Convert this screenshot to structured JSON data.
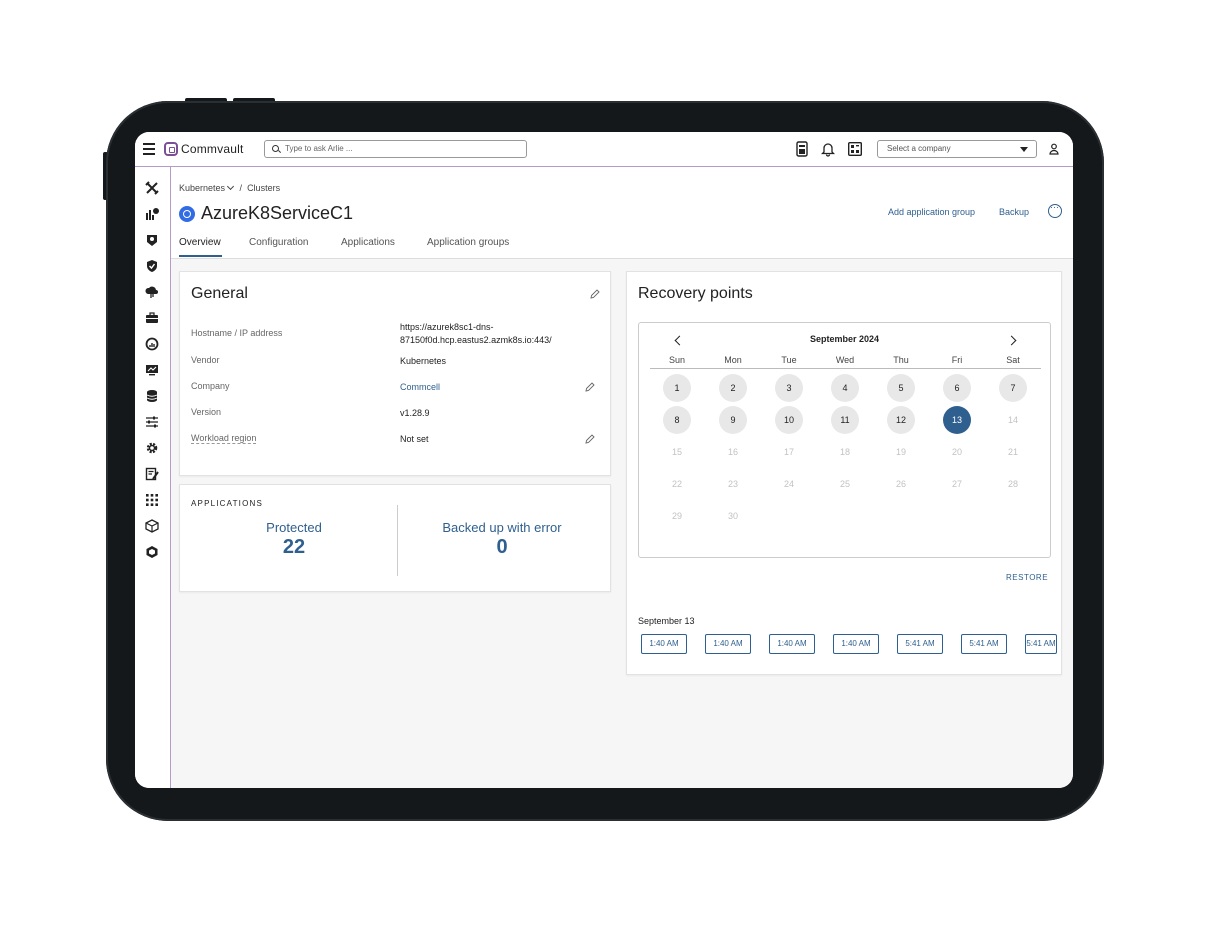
{
  "topbar": {
    "brand": "Commvault",
    "search_placeholder": "Type to ask Arlie ...",
    "company_select": "Select a company"
  },
  "breadcrumb": {
    "parent": "Kubernetes",
    "current": "Clusters"
  },
  "page": {
    "title": "AzureK8ServiceC1",
    "actions": {
      "add_group": "Add application group",
      "backup": "Backup"
    },
    "tabs": [
      "Overview",
      "Configuration",
      "Applications",
      "Application groups"
    ],
    "active_tab": "Overview"
  },
  "general": {
    "title": "General",
    "rows": [
      {
        "label": "Hostname / IP address",
        "value_line1": "https://azurek8sc1-dns-",
        "value_line2": "87150f0d.hcp.eastus2.azmk8s.io:443/"
      },
      {
        "label": "Vendor",
        "value": "Kubernetes"
      },
      {
        "label": "Company",
        "value": "Commcell"
      },
      {
        "label": "Version",
        "value": "v1.28.9"
      },
      {
        "label": "Workload region",
        "value": "Not set"
      }
    ]
  },
  "applications": {
    "label": "APPLICATIONS",
    "protected_label": "Protected",
    "protected_value": "22",
    "error_label": "Backed up with error",
    "error_value": "0"
  },
  "recovery": {
    "title": "Recovery points",
    "month": "September 2024",
    "weekdays": [
      "Sun",
      "Mon",
      "Tue",
      "Wed",
      "Thu",
      "Fri",
      "Sat"
    ],
    "weeks": [
      [
        "1",
        "2",
        "3",
        "4",
        "5",
        "6",
        "7"
      ],
      [
        "8",
        "9",
        "10",
        "11",
        "12",
        "13",
        "14"
      ],
      [
        "15",
        "16",
        "17",
        "18",
        "19",
        "20",
        "21"
      ],
      [
        "22",
        "23",
        "24",
        "25",
        "26",
        "27",
        "28"
      ],
      [
        "29",
        "30",
        "",
        "",
        "",
        "",
        ""
      ]
    ],
    "available_days": [
      "1",
      "2",
      "3",
      "4",
      "5",
      "6",
      "7",
      "8",
      "9",
      "10",
      "11",
      "12"
    ],
    "selected_day": "13",
    "restore_label": "RESTORE",
    "selected_date_label": "September 13",
    "times": [
      "1:40 AM",
      "1:40 AM",
      "1:40 AM",
      "1:40 AM",
      "5:41 AM",
      "5:41 AM",
      "5:41 AM"
    ]
  },
  "colors": {
    "accent": "#2f5f8e",
    "brand": "#7a4f96",
    "divider": "#b69bc9",
    "selected_day": "#2f5f8e"
  }
}
